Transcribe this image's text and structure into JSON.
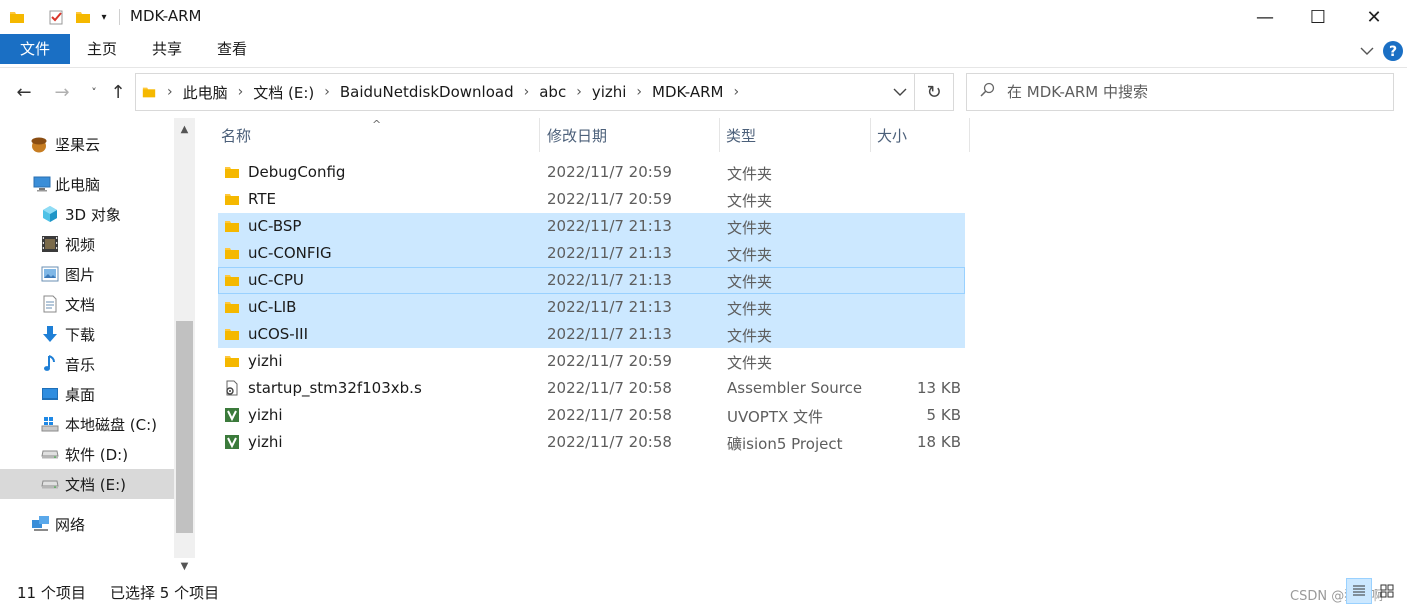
{
  "window": {
    "title": "MDK-ARM",
    "quick_access_icons": [
      "folder-icon",
      "properties-checkmark-icon",
      "new-folder-icon",
      "customize-dropdown-icon"
    ],
    "controls": {
      "minimize": "—",
      "maximize": "☐",
      "close": "✕"
    }
  },
  "ribbon": {
    "tabs": [
      "文件",
      "主页",
      "共享",
      "查看"
    ],
    "accent": "#1a6fc4"
  },
  "address": {
    "crumbs": [
      "此电脑",
      "文档 (E:)",
      "BaiduNetdiskDownload",
      "abc",
      "yizhi",
      "MDK-ARM"
    ]
  },
  "search": {
    "placeholder": "在 MDK-ARM 中搜索"
  },
  "sidebar": {
    "items": [
      {
        "label": "坚果云",
        "icon": "nutstore-icon"
      },
      {
        "label": "此电脑",
        "icon": "this-pc-icon"
      },
      {
        "label": "3D 对象",
        "icon": "3d-objects-icon"
      },
      {
        "label": "视频",
        "icon": "videos-icon"
      },
      {
        "label": "图片",
        "icon": "pictures-icon"
      },
      {
        "label": "文档",
        "icon": "documents-icon"
      },
      {
        "label": "下载",
        "icon": "downloads-icon"
      },
      {
        "label": "音乐",
        "icon": "music-icon"
      },
      {
        "label": "桌面",
        "icon": "desktop-icon"
      },
      {
        "label": "本地磁盘 (C:)",
        "icon": "windows-drive-icon"
      },
      {
        "label": "软件 (D:)",
        "icon": "drive-icon"
      },
      {
        "label": "文档 (E:)",
        "icon": "drive-icon",
        "selected": true
      },
      {
        "label": "网络",
        "icon": "network-icon"
      }
    ]
  },
  "columns": {
    "name": "名称",
    "date": "修改日期",
    "type": "类型",
    "size": "大小"
  },
  "files": [
    {
      "name": "DebugConfig",
      "date": "2022/11/7 20:59",
      "type": "文件夹",
      "size": "",
      "icon": "folder-icon",
      "state": ""
    },
    {
      "name": "RTE",
      "date": "2022/11/7 20:59",
      "type": "文件夹",
      "size": "",
      "icon": "folder-icon",
      "state": ""
    },
    {
      "name": "uC-BSP",
      "date": "2022/11/7 21:13",
      "type": "文件夹",
      "size": "",
      "icon": "folder-icon",
      "state": "sel"
    },
    {
      "name": "uC-CONFIG",
      "date": "2022/11/7 21:13",
      "type": "文件夹",
      "size": "",
      "icon": "folder-icon",
      "state": "sel"
    },
    {
      "name": "uC-CPU",
      "date": "2022/11/7 21:13",
      "type": "文件夹",
      "size": "",
      "icon": "folder-icon",
      "state": "focus"
    },
    {
      "name": "uC-LIB",
      "date": "2022/11/7 21:13",
      "type": "文件夹",
      "size": "",
      "icon": "folder-icon",
      "state": "sel"
    },
    {
      "name": "uCOS-III",
      "date": "2022/11/7 21:13",
      "type": "文件夹",
      "size": "",
      "icon": "folder-icon",
      "state": "sel"
    },
    {
      "name": "yizhi",
      "date": "2022/11/7 20:59",
      "type": "文件夹",
      "size": "",
      "icon": "folder-icon",
      "state": ""
    },
    {
      "name": "startup_stm32f103xb.s",
      "date": "2022/11/7 20:58",
      "type": "Assembler Source",
      "size": "13 KB",
      "icon": "assembler-file-icon",
      "state": ""
    },
    {
      "name": "yizhi",
      "date": "2022/11/7 20:58",
      "type": "UVOPTX 文件",
      "size": "5 KB",
      "icon": "keil-uvision-icon",
      "state": ""
    },
    {
      "name": "yizhi",
      "date": "2022/11/7 20:58",
      "type": "礦ision5 Project",
      "size": "18 KB",
      "icon": "keil-uvision-icon",
      "state": ""
    }
  ],
  "status": {
    "count": "11 个项目",
    "selected": "已选择 5 个项目",
    "watermark": "CSDN @猪儿啊"
  },
  "colors": {
    "selection": "#cce8ff",
    "selection_border": "#99d1ff",
    "folder": "#ffc83d",
    "help": "#1a6fc4"
  }
}
